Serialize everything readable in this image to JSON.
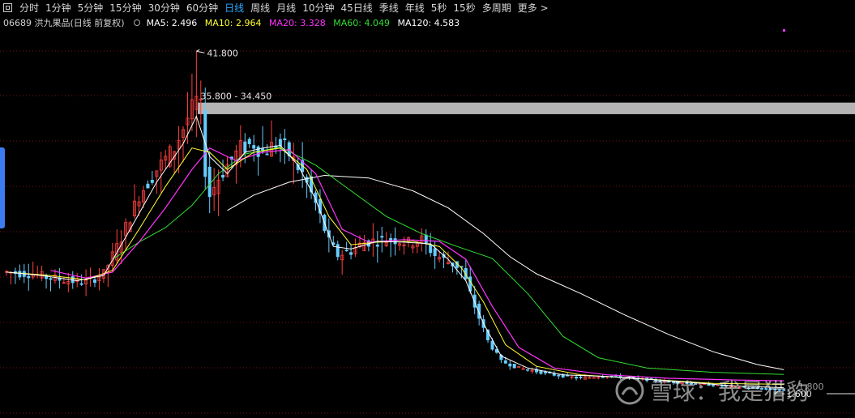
{
  "toolbar": {
    "periods": [
      {
        "label": "分时"
      },
      {
        "label": "1分钟"
      },
      {
        "label": "5分钟"
      },
      {
        "label": "15分钟"
      },
      {
        "label": "30分钟"
      },
      {
        "label": "60分钟"
      },
      {
        "label": "日线"
      },
      {
        "label": "周线"
      },
      {
        "label": "月线"
      },
      {
        "label": "10分钟"
      },
      {
        "label": "45日线"
      },
      {
        "label": "季线"
      },
      {
        "label": "年线"
      },
      {
        "label": "5秒"
      },
      {
        "label": "15秒"
      },
      {
        "label": "多周期"
      }
    ],
    "active_label": "日线",
    "more_label": "更多 >"
  },
  "info": {
    "stock": "06689 洪九果品(日线 前复权)",
    "ma5": "MA5: 2.496",
    "ma10": "MA10: 2.964",
    "ma20": "MA20: 3.328",
    "ma60": "MA60: 4.049",
    "ma120": "MA120: 4.583"
  },
  "colors": {
    "ma5": "#ffffff",
    "ma10": "#ffff33",
    "ma20": "#ff33ff",
    "ma60": "#33dd33",
    "ma120": "#ffffff",
    "up": "#ff4040",
    "down": "#66ccff",
    "grid": "#7a1515",
    "band": "#b4b4b4",
    "active": "#2ea7ff"
  },
  "annotations": {
    "high_label": "41.800",
    "band_label": "35.800 - 34.450",
    "low_label": "1.600",
    "right_price": "1.800"
  },
  "watermark": {
    "text": "雪球：我是猎豹"
  },
  "chart_data": {
    "type": "candlestick",
    "title": "06689 洪九果品(日线 前复权)",
    "ylim": [
      0,
      44
    ],
    "price_band": [
      34.45,
      35.8
    ],
    "high": 41.8,
    "low": 1.6,
    "series": [
      {
        "name": "MA5",
        "value": 2.496
      },
      {
        "name": "MA10",
        "value": 2.964
      },
      {
        "name": "MA20",
        "value": 3.328
      },
      {
        "name": "MA60",
        "value": 4.049
      },
      {
        "name": "MA120",
        "value": 4.583
      }
    ],
    "segments": [
      [
        0,
        16.0
      ],
      [
        6,
        15.8
      ],
      [
        10,
        15.3
      ],
      [
        14,
        15.0
      ],
      [
        18,
        14.8
      ],
      [
        22,
        15.8
      ],
      [
        26,
        20.0
      ],
      [
        30,
        25.0
      ],
      [
        34,
        28.0
      ],
      [
        38,
        30.5
      ],
      [
        41,
        34.0
      ],
      [
        43,
        36.0
      ],
      [
        44,
        35.0
      ],
      [
        45,
        28.0
      ],
      [
        46,
        25.0
      ],
      [
        48,
        27.0
      ],
      [
        50,
        28.5
      ],
      [
        53,
        30.5
      ],
      [
        56,
        31.0
      ],
      [
        58,
        30.0
      ],
      [
        61,
        31.0
      ],
      [
        63,
        30.5
      ],
      [
        65,
        29.0
      ],
      [
        67,
        27.5
      ],
      [
        70,
        24.0
      ],
      [
        73,
        19.5
      ],
      [
        75,
        18.0
      ],
      [
        78,
        18.5
      ],
      [
        81,
        19.5
      ],
      [
        84,
        19.7
      ],
      [
        88,
        19.8
      ],
      [
        91,
        19.4
      ],
      [
        94,
        19.8
      ],
      [
        97,
        18.0
      ],
      [
        100,
        17.2
      ],
      [
        103,
        16.5
      ],
      [
        106,
        12.0
      ],
      [
        109,
        8.0
      ],
      [
        112,
        5.6
      ],
      [
        116,
        4.8
      ],
      [
        120,
        4.4
      ],
      [
        124,
        4.0
      ],
      [
        130,
        3.6
      ],
      [
        136,
        3.9
      ],
      [
        142,
        3.6
      ],
      [
        150,
        3.2
      ],
      [
        160,
        2.8
      ],
      [
        170,
        2.4
      ],
      [
        176,
        2.2
      ]
    ],
    "ma_curves": {
      "ma5": [
        [
          0,
          16.0
        ],
        [
          8,
          15.6
        ],
        [
          16,
          15.0
        ],
        [
          22,
          15.6
        ],
        [
          28,
          21.0
        ],
        [
          34,
          26.5
        ],
        [
          40,
          31.0
        ],
        [
          43,
          34.2
        ],
        [
          46,
          29.5
        ],
        [
          50,
          27.5
        ],
        [
          54,
          30.0
        ],
        [
          58,
          30.5
        ],
        [
          62,
          30.8
        ],
        [
          66,
          28.5
        ],
        [
          70,
          24.5
        ],
        [
          74,
          19.0
        ],
        [
          78,
          18.7
        ],
        [
          84,
          19.6
        ],
        [
          90,
          19.5
        ],
        [
          96,
          19.3
        ],
        [
          100,
          17.5
        ],
        [
          104,
          15.0
        ],
        [
          108,
          10.0
        ],
        [
          112,
          6.2
        ],
        [
          118,
          4.8
        ],
        [
          126,
          4.0
        ],
        [
          136,
          3.8
        ],
        [
          150,
          3.3
        ],
        [
          165,
          2.7
        ],
        [
          176,
          2.5
        ]
      ],
      "ma10": [
        [
          0,
          16.0
        ],
        [
          10,
          15.6
        ],
        [
          18,
          15.1
        ],
        [
          24,
          16.2
        ],
        [
          30,
          21.0
        ],
        [
          36,
          26.0
        ],
        [
          42,
          30.5
        ],
        [
          46,
          30.0
        ],
        [
          50,
          28.0
        ],
        [
          56,
          30.0
        ],
        [
          62,
          30.5
        ],
        [
          68,
          28.0
        ],
        [
          73,
          22.5
        ],
        [
          78,
          19.2
        ],
        [
          84,
          19.5
        ],
        [
          92,
          19.6
        ],
        [
          98,
          19.0
        ],
        [
          103,
          16.5
        ],
        [
          108,
          12.5
        ],
        [
          113,
          7.5
        ],
        [
          120,
          5.0
        ],
        [
          130,
          4.0
        ],
        [
          145,
          3.5
        ],
        [
          160,
          3.0
        ],
        [
          176,
          2.9
        ]
      ],
      "ma20": [
        [
          10,
          16.2
        ],
        [
          18,
          15.3
        ],
        [
          24,
          16.0
        ],
        [
          30,
          19.5
        ],
        [
          36,
          23.5
        ],
        [
          42,
          28.0
        ],
        [
          46,
          30.5
        ],
        [
          52,
          29.0
        ],
        [
          58,
          30.0
        ],
        [
          64,
          30.3
        ],
        [
          70,
          27.5
        ],
        [
          76,
          21.0
        ],
        [
          82,
          19.5
        ],
        [
          90,
          19.8
        ],
        [
          98,
          19.6
        ],
        [
          104,
          17.5
        ],
        [
          110,
          12.0
        ],
        [
          116,
          7.2
        ],
        [
          124,
          4.8
        ],
        [
          136,
          4.0
        ],
        [
          150,
          3.6
        ],
        [
          165,
          3.4
        ],
        [
          176,
          3.3
        ]
      ],
      "ma60": [
        [
          24,
          17.5
        ],
        [
          30,
          19.5
        ],
        [
          36,
          21.2
        ],
        [
          42,
          23.8
        ],
        [
          48,
          27.5
        ],
        [
          54,
          29.8
        ],
        [
          62,
          30.6
        ],
        [
          70,
          28.5
        ],
        [
          78,
          25.5
        ],
        [
          86,
          22.5
        ],
        [
          94,
          20.5
        ],
        [
          102,
          19.0
        ],
        [
          110,
          17.6
        ],
        [
          118,
          13.5
        ],
        [
          126,
          8.5
        ],
        [
          134,
          6.0
        ],
        [
          145,
          4.8
        ],
        [
          160,
          4.3
        ],
        [
          176,
          4.05
        ]
      ],
      "ma120": [
        [
          50,
          23.2
        ],
        [
          56,
          25.0
        ],
        [
          64,
          26.5
        ],
        [
          72,
          27.3
        ],
        [
          82,
          27.0
        ],
        [
          92,
          25.5
        ],
        [
          100,
          23.5
        ],
        [
          108,
          20.5
        ],
        [
          114,
          17.8
        ],
        [
          120,
          15.8
        ],
        [
          130,
          13.5
        ],
        [
          140,
          11.0
        ],
        [
          150,
          8.7
        ],
        [
          160,
          6.7
        ],
        [
          170,
          5.2
        ],
        [
          176,
          4.6
        ]
      ]
    }
  }
}
